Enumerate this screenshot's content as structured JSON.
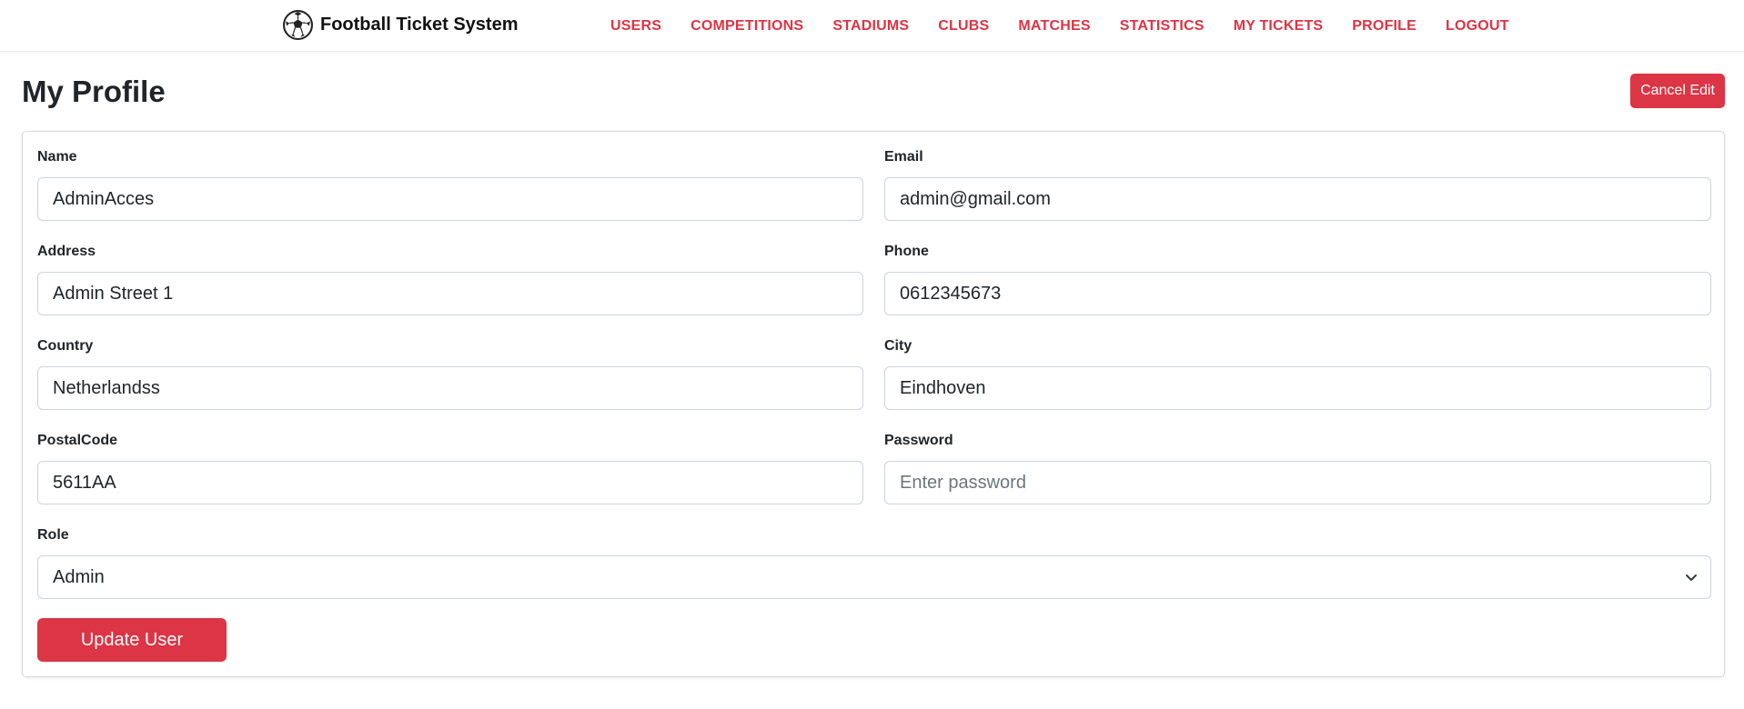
{
  "app": {
    "title": "Football Ticket System",
    "logo_icon": "soccer-ball-icon"
  },
  "nav": {
    "items": [
      {
        "label": "USERS"
      },
      {
        "label": "COMPETITIONS"
      },
      {
        "label": "STADIUMS"
      },
      {
        "label": "CLUBS"
      },
      {
        "label": "MATCHES"
      },
      {
        "label": "STATISTICS"
      },
      {
        "label": "MY TICKETS"
      },
      {
        "label": "PROFILE"
      },
      {
        "label": "LOGOUT"
      }
    ]
  },
  "page": {
    "title": "My Profile",
    "cancel_label": "Cancel Edit"
  },
  "form": {
    "name": {
      "label": "Name",
      "value": "AdminAcces"
    },
    "email": {
      "label": "Email",
      "value": "admin@gmail.com"
    },
    "address": {
      "label": "Address",
      "value": "Admin Street 1"
    },
    "phone": {
      "label": "Phone",
      "value": "0612345673"
    },
    "country": {
      "label": "Country",
      "value": "Netherlandss"
    },
    "city": {
      "label": "City",
      "value": "Eindhoven"
    },
    "postal": {
      "label": "PostalCode",
      "value": "5611AA"
    },
    "password": {
      "label": "Password",
      "value": "",
      "placeholder": "Enter password"
    },
    "role": {
      "label": "Role",
      "value": "Admin"
    },
    "submit_label": "Update User"
  },
  "colors": {
    "accent": "#dc3545",
    "text": "#212529",
    "border": "#ced4da"
  }
}
